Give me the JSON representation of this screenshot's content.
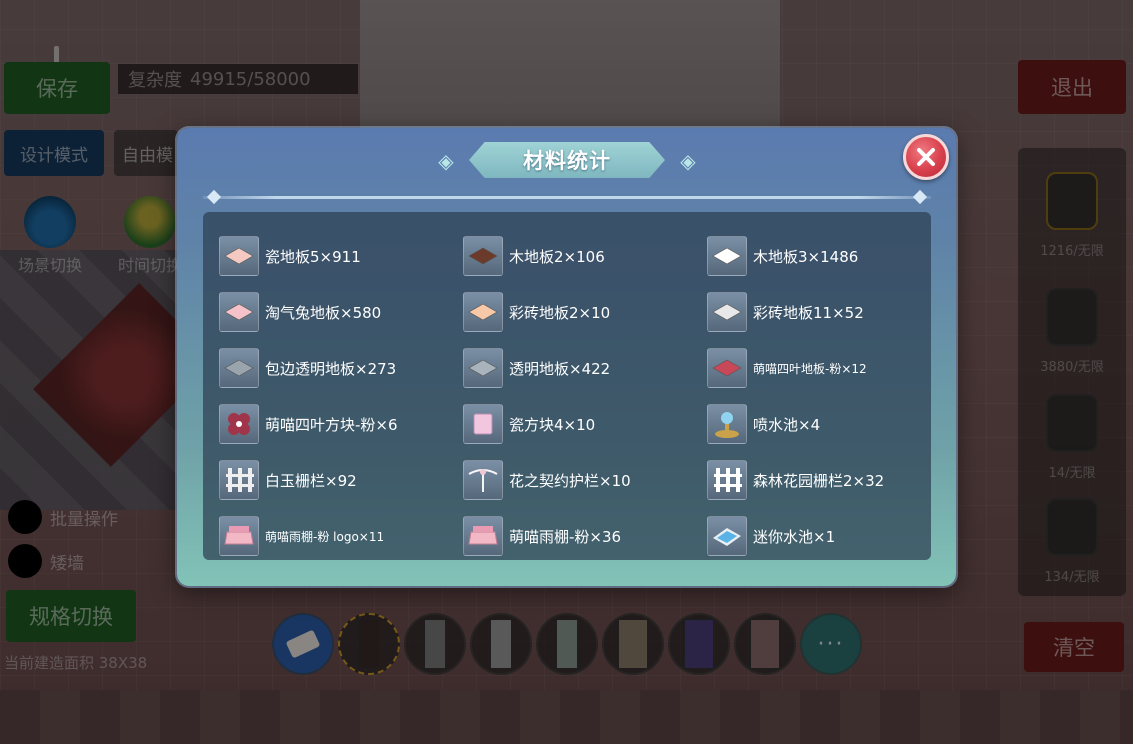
{
  "hud": {
    "save_label": "保存",
    "design_mode_label": "设计模式",
    "free_mode_label": "自由模",
    "complexity_label": "复杂度",
    "complexity_value": "49915/58000",
    "exit_label": "退出",
    "scene_toggle_label": "场景切换",
    "time_toggle_label": "时间切换",
    "batch_op_label": "批量操作",
    "short_wall_label": "矮墙",
    "spec_toggle_label": "规格切换",
    "build_area_text": "当前建造面积 38X38",
    "clear_label": "清空",
    "right_counts": [
      "1216/无限",
      "3880/无限",
      "14/无限",
      "134/无限"
    ],
    "more_label": "···"
  },
  "modal": {
    "title": "材料统计",
    "items": [
      {
        "label": "瓷地板5×911",
        "icon": "pink-floor-tile-icon",
        "color": "#f3c9c2"
      },
      {
        "label": "木地板2×106",
        "icon": "brown-wood-floor-icon",
        "color": "#6b3a2a"
      },
      {
        "label": "木地板3×1486",
        "icon": "white-wood-floor-icon",
        "color": "#ffffff"
      },
      {
        "label": "淘气兔地板×580",
        "icon": "bunny-floor-icon",
        "color": "#f4c2c8"
      },
      {
        "label": "彩砖地板2×10",
        "icon": "peach-brick-floor-icon",
        "color": "#f7c9a8"
      },
      {
        "label": "彩砖地板11×52",
        "icon": "white-brick-floor-icon",
        "color": "#e8e8ea"
      },
      {
        "label": "包边透明地板×273",
        "icon": "edged-glass-floor-icon",
        "color": "#9aa4ad"
      },
      {
        "label": "透明地板×422",
        "icon": "glass-floor-icon",
        "color": "#a9b3bc"
      },
      {
        "label": "萌喵四叶地板-粉×12",
        "icon": "cat-clover-floor-icon",
        "color": "#c8485a",
        "small": true
      },
      {
        "label": "萌喵四叶方块-粉×6",
        "icon": "cat-clover-block-icon",
        "color": "#a0344a"
      },
      {
        "label": "瓷方块4×10",
        "icon": "pink-cube-icon",
        "color": "#f3c6e0"
      },
      {
        "label": "喷水池×4",
        "icon": "fountain-icon",
        "color": "#c9a24a"
      },
      {
        "label": "白玉栅栏×92",
        "icon": "white-jade-fence-icon",
        "color": "#eeeeee"
      },
      {
        "label": "花之契约护栏×10",
        "icon": "flower-ribbon-railing-icon",
        "color": "#f5f5f5"
      },
      {
        "label": "森林花园栅栏2×32",
        "icon": "garden-fence-icon",
        "color": "#ffffff"
      },
      {
        "label": "萌喵雨棚-粉 logo×11",
        "icon": "cat-awning-logo-icon",
        "color": "#f2b8c6",
        "small": true
      },
      {
        "label": "萌喵雨棚-粉×36",
        "icon": "cat-awning-icon",
        "color": "#f2b8c6"
      },
      {
        "label": "迷你水池×1",
        "icon": "mini-pool-icon",
        "color": "#5ab3e6"
      }
    ]
  }
}
